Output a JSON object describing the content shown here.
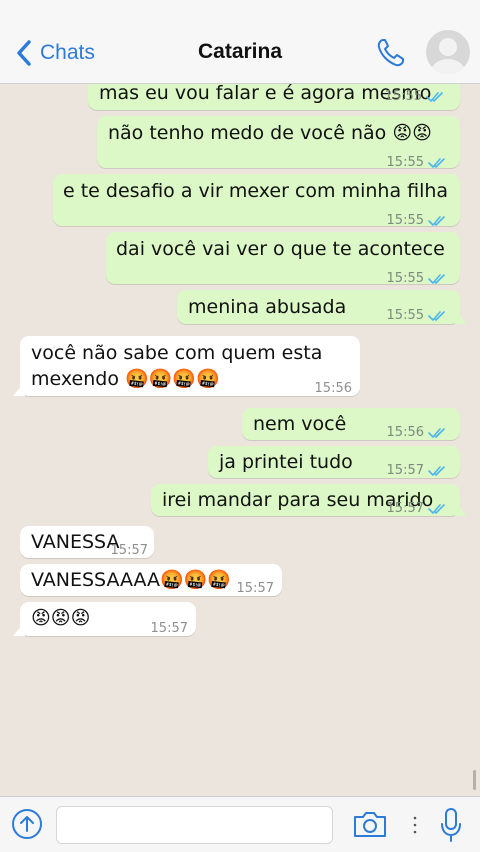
{
  "header": {
    "back_label": "Chats",
    "contact_name": "Catarina"
  },
  "messages": [
    {
      "direction": "out",
      "text": "mas eu vou falar e é agora mesmo",
      "time": "15:55",
      "status": "read"
    },
    {
      "direction": "out",
      "text": "não tenho medo de você não 😡😡",
      "time": "15:55",
      "status": "read"
    },
    {
      "direction": "out",
      "text": "e te desafio a vir mexer com minha filha",
      "time": "15:55",
      "status": "read"
    },
    {
      "direction": "out",
      "text": "dai você vai ver o que te acontece",
      "time": "15:55",
      "status": "read"
    },
    {
      "direction": "out",
      "text": "menina abusada",
      "time": "15:55",
      "status": "read"
    },
    {
      "direction": "in",
      "text_line1": "você não sabe com quem esta",
      "text_line2": "mexendo 🤬🤬🤬🤬",
      "time": "15:56"
    },
    {
      "direction": "out",
      "text": "nem você",
      "time": "15:56",
      "status": "read"
    },
    {
      "direction": "out",
      "text": "ja printei tudo",
      "time": "15:57",
      "status": "read"
    },
    {
      "direction": "out",
      "text": "irei mandar para seu marido",
      "time": "15:57",
      "status": "read"
    },
    {
      "direction": "in",
      "text": "VANESSA",
      "time": "15:57"
    },
    {
      "direction": "in",
      "text": "VANESSAAAA🤬🤬🤬",
      "time": "15:57"
    },
    {
      "direction": "in",
      "text": "😡😡😡",
      "time": "15:57"
    }
  ],
  "input": {
    "placeholder": ""
  },
  "colors": {
    "accent": "#2d7bd8",
    "outgoing_bubble": "#dcf8c6",
    "incoming_bubble": "#ffffff",
    "chat_background": "#ece5dd",
    "read_ticks": "#4fb6ec"
  },
  "icons": [
    "back-chevron-icon",
    "phone-icon",
    "avatar-placeholder",
    "upload-icon",
    "camera-icon",
    "more-dots-icon",
    "microphone-icon"
  ]
}
